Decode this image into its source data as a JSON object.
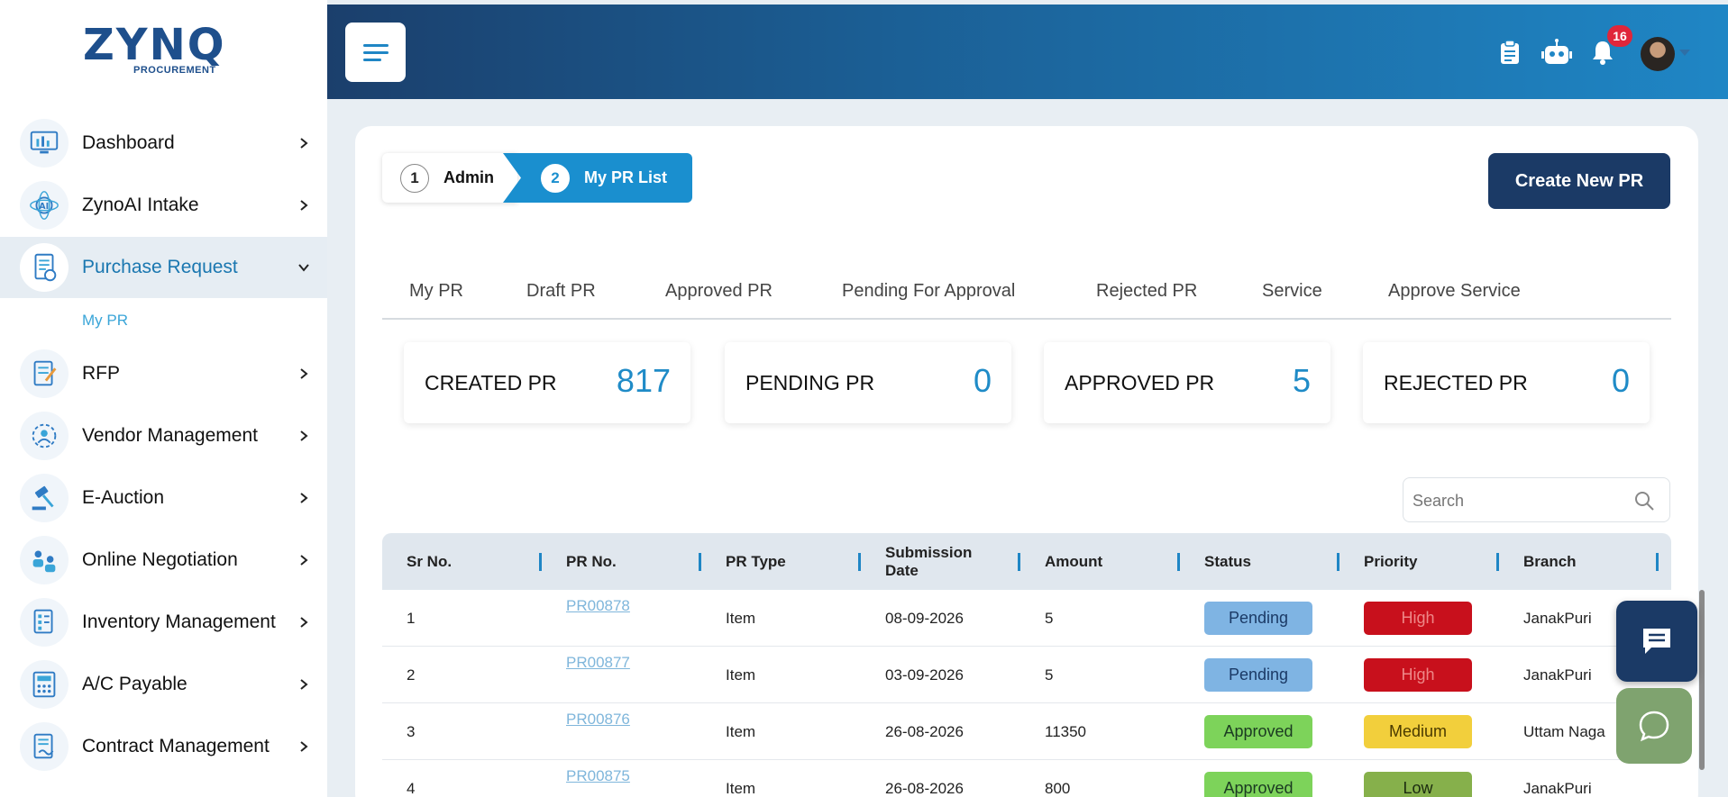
{
  "brand": {
    "name": "ZYNQ",
    "sub": "PROCUREMENT"
  },
  "sidebar": {
    "items": [
      {
        "label": "Dashboard",
        "icon": "dashboard-icon"
      },
      {
        "label": "ZynoAI Intake",
        "icon": "ai-icon"
      },
      {
        "label": "Purchase Request",
        "icon": "purchase-request-icon",
        "active": true
      },
      {
        "label": "RFP",
        "icon": "rfp-icon"
      },
      {
        "label": "Vendor Management",
        "icon": "vendor-icon"
      },
      {
        "label": "E-Auction",
        "icon": "auction-icon"
      },
      {
        "label": "Online Negotiation",
        "icon": "negotiation-icon"
      },
      {
        "label": "Inventory Management",
        "icon": "inventory-icon"
      },
      {
        "label": "A/C Payable",
        "icon": "payable-icon"
      },
      {
        "label": "Contract Management",
        "icon": "contract-icon"
      }
    ],
    "submenu": "My PR"
  },
  "header": {
    "notification_count": "16"
  },
  "stepper": [
    {
      "num": "1",
      "label": "Admin"
    },
    {
      "num": "2",
      "label": "My PR List"
    }
  ],
  "create_button": "Create New PR",
  "tabs": [
    "My PR",
    "Draft PR",
    "Approved PR",
    "Pending For Approval",
    "Rejected PR",
    "Service",
    "Approve Service"
  ],
  "stats": [
    {
      "label": "CREATED PR",
      "value": "817"
    },
    {
      "label": "PENDING PR",
      "value": "0"
    },
    {
      "label": "APPROVED PR",
      "value": "5"
    },
    {
      "label": "REJECTED PR",
      "value": "0"
    }
  ],
  "search": {
    "placeholder": "Search"
  },
  "table": {
    "columns": [
      "Sr No.",
      "PR No.",
      "PR Type",
      "Submission Date",
      "Amount",
      "Status",
      "Priority",
      "Branch"
    ],
    "rows": [
      {
        "sr": "1",
        "pr": "PR00878",
        "type": "Item",
        "date": "08-09-2026",
        "amount": "5",
        "status": "Pending",
        "priority": "High",
        "branch": "JanakPuri"
      },
      {
        "sr": "2",
        "pr": "PR00877",
        "type": "Item",
        "date": "03-09-2026",
        "amount": "5",
        "status": "Pending",
        "priority": "High",
        "branch": "JanakPuri"
      },
      {
        "sr": "3",
        "pr": "PR00876",
        "type": "Item",
        "date": "26-08-2026",
        "amount": "11350",
        "status": "Approved",
        "priority": "Medium",
        "branch": "Uttam Naga"
      },
      {
        "sr": "4",
        "pr": "PR00875",
        "type": "Item",
        "date": "26-08-2026",
        "amount": "800",
        "status": "Approved",
        "priority": "Low",
        "branch": "JanakPuri"
      }
    ]
  },
  "colors": {
    "accent": "#1f8bc7",
    "navy": "#1b3a66",
    "pending": "#7fb4e3",
    "approved": "#7dd35a",
    "high": "#c8101c",
    "medium": "#f2cf3c",
    "low": "#86b04b"
  }
}
